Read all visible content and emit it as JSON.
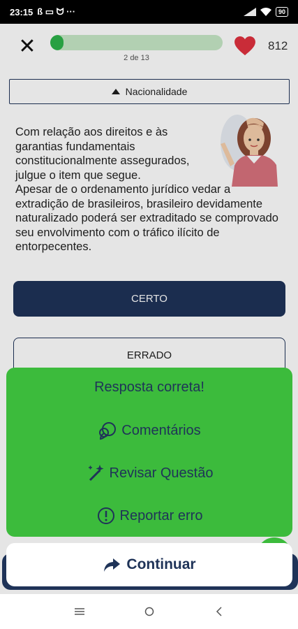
{
  "status_bar": {
    "time": "23:15",
    "extra_icons": "ß ▭ ᗢ ···",
    "battery": "90"
  },
  "header": {
    "progress_label": "2 de 13",
    "progress_fraction": 0.077,
    "lives": "812"
  },
  "category": {
    "label": "Nacionalidade"
  },
  "question": {
    "intro": "Com relação aos direitos e às garantias fundamentais constitucionalmente assegurados, julgue o item que segue.",
    "statement": "Apesar de o ordenamento jurídico vedar a extradição de brasileiros, brasileiro devidamente naturalizado poderá ser extraditado se comprovado seu envolvimento com o tráfico ilícito de entorpecentes."
  },
  "answers": {
    "certo": "CERTO",
    "errado": "ERRADO"
  },
  "feedback": {
    "title": "Resposta correta!",
    "comments": "Comentários",
    "review": "Revisar Questão",
    "report": "Reportar erro"
  },
  "continue_label": "Continuar",
  "icons": {
    "close": "close-icon",
    "heart": "heart-icon",
    "comments": "chat-bubble-icon",
    "review": "magic-wand-icon",
    "report": "alert-circle-icon",
    "continue": "share-arrow-icon"
  },
  "colors": {
    "navy": "#1f3358",
    "green": "#3cbb3c",
    "progress": "#2db34a",
    "heart": "#e0313f"
  }
}
